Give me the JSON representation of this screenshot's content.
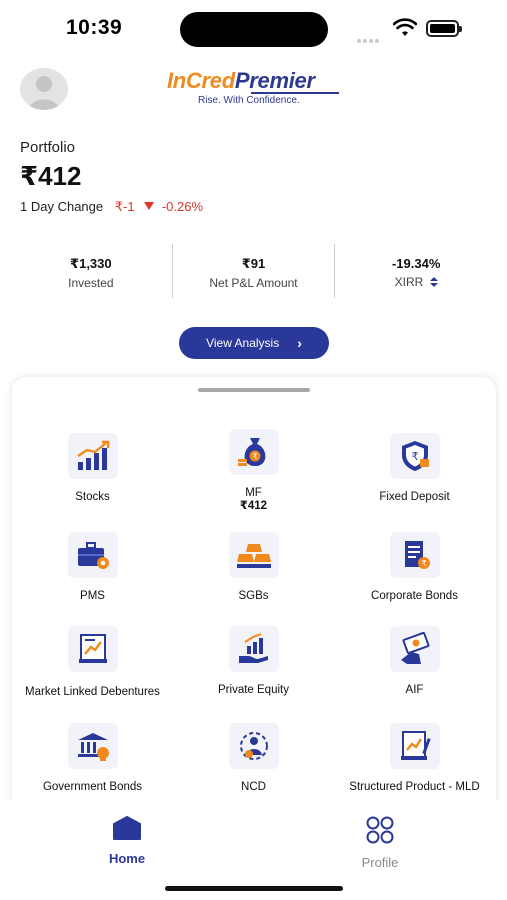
{
  "status_bar": {
    "time": "10:39"
  },
  "header": {
    "logo_in": "InCred",
    "logo_premier": "Premier",
    "logo_tagline": "Rise. With Confidence."
  },
  "portfolio": {
    "label": "Portfolio",
    "value": "₹412",
    "day_change_label": "1 Day Change",
    "day_change_amount": "₹-1",
    "day_change_percent": "-0.26%"
  },
  "stats": [
    {
      "value": "₹1,330",
      "label": "Invested"
    },
    {
      "value": "₹91",
      "label": "Net P&L Amount"
    },
    {
      "value": "-19.34%",
      "label": "XIRR"
    }
  ],
  "view_analysis_label": "View Analysis",
  "products": [
    {
      "label": "Stocks",
      "sub": ""
    },
    {
      "label": "MF",
      "sub": "₹412"
    },
    {
      "label": "Fixed Deposit",
      "sub": ""
    },
    {
      "label": "PMS",
      "sub": ""
    },
    {
      "label": "SGBs",
      "sub": ""
    },
    {
      "label": "Corporate Bonds",
      "sub": ""
    },
    {
      "label": "Market Linked Debentures",
      "sub": ""
    },
    {
      "label": "Private Equity",
      "sub": ""
    },
    {
      "label": "AIF",
      "sub": ""
    },
    {
      "label": "Government Bonds",
      "sub": ""
    },
    {
      "label": "NCD",
      "sub": ""
    },
    {
      "label": "Structured Product - MLD",
      "sub": ""
    }
  ],
  "bottom_nav": {
    "home": "Home",
    "profile": "Profile"
  },
  "colors": {
    "brand_blue": "#2a3899",
    "brand_orange": "#f08a1d",
    "negative": "#e0342a",
    "inactive": "#8a8a8a"
  }
}
